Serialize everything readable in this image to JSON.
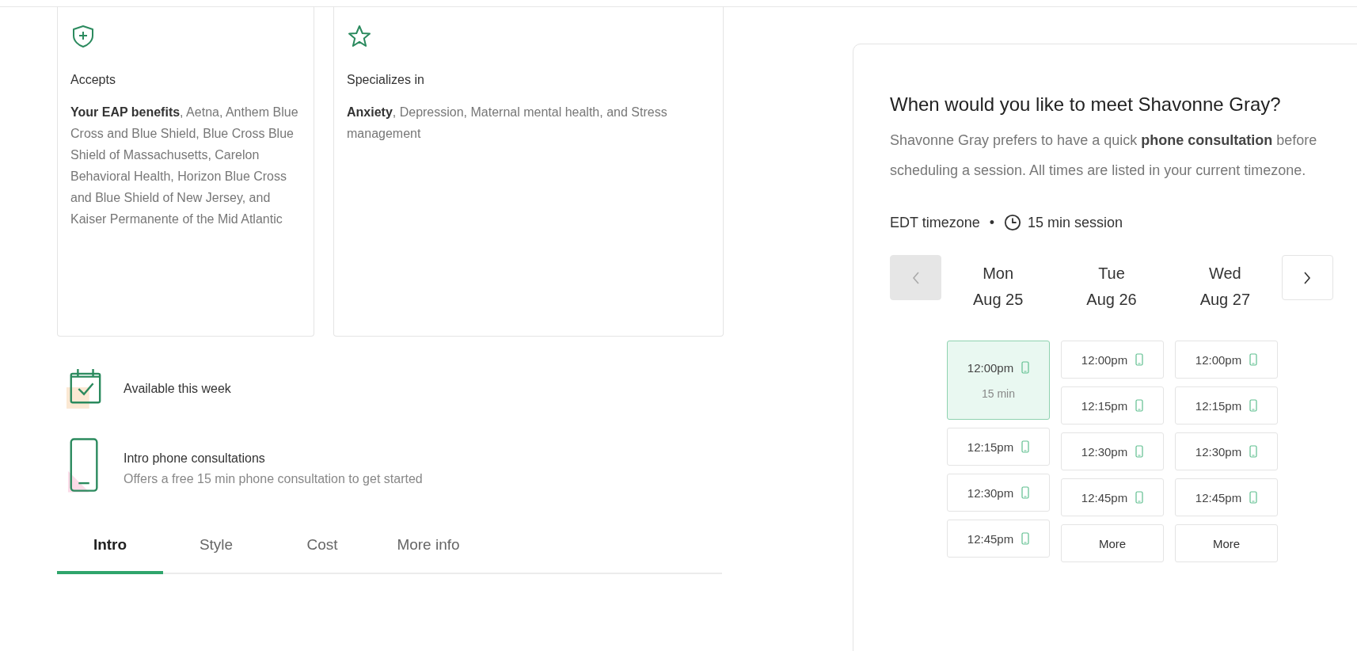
{
  "cards": [
    {
      "kind": "shield",
      "title": "Accepts",
      "text": "**Your EAP benefits**, Aetna, Anthem Blue Cross and Blue Shield, Blue Cross Blue Shield of Massachusetts, Carelon Behavioral Health, Horizon Blue Cross and Blue Shield of New Jersey, and Kaiser Permanente of the Mid Atlantic"
    },
    {
      "kind": "star",
      "title": "Specializes in",
      "text": "**Anxiety**, Depression, Maternal mental health, and Stress management"
    }
  ],
  "features": [
    {
      "kind": "calendar",
      "title": "Available this week"
    },
    {
      "kind": "phone",
      "title": "Intro phone consultations",
      "subtitle": "Offers a free 15 min phone consultation to get started"
    }
  ],
  "tabs": [
    {
      "label": "Intro",
      "selected": true
    },
    {
      "label": "Style",
      "selected": false
    },
    {
      "label": "Cost",
      "selected": false
    },
    {
      "label": "More info",
      "selected": false
    }
  ],
  "booking": {
    "title": "When would you like to meet Shavonne Gray?",
    "description": "Shavonne Gray prefers to have a quick **phone consultation** before scheduling a session. All times are listed in your current timezone.",
    "timezone": "EDT timezone",
    "separator": "•",
    "session": "15 min session",
    "prev_disabled": true,
    "next_disabled": false,
    "days": [
      {
        "weekday": "Mon",
        "date": "Aug 25",
        "slots": [
          {
            "kind": "time",
            "label": "12:00pm",
            "selected": true,
            "detail": "15 min"
          },
          {
            "kind": "time",
            "label": "12:15pm",
            "selected": false
          },
          {
            "kind": "time",
            "label": "12:30pm",
            "selected": false
          },
          {
            "kind": "time",
            "label": "12:45pm",
            "selected": false
          }
        ]
      },
      {
        "weekday": "Tue",
        "date": "Aug 26",
        "slots": [
          {
            "kind": "time",
            "label": "12:00pm",
            "selected": false
          },
          {
            "kind": "time",
            "label": "12:15pm",
            "selected": false
          },
          {
            "kind": "time",
            "label": "12:30pm",
            "selected": false
          },
          {
            "kind": "time",
            "label": "12:45pm",
            "selected": false
          },
          {
            "kind": "more",
            "label": "More",
            "selected": false
          }
        ]
      },
      {
        "weekday": "Wed",
        "date": "Aug 27",
        "slots": [
          {
            "kind": "time",
            "label": "12:00pm",
            "selected": false
          },
          {
            "kind": "time",
            "label": "12:15pm",
            "selected": false
          },
          {
            "kind": "time",
            "label": "12:30pm",
            "selected": false
          },
          {
            "kind": "time",
            "label": "12:45pm",
            "selected": false
          },
          {
            "kind": "more",
            "label": "More",
            "selected": false
          }
        ]
      }
    ]
  }
}
